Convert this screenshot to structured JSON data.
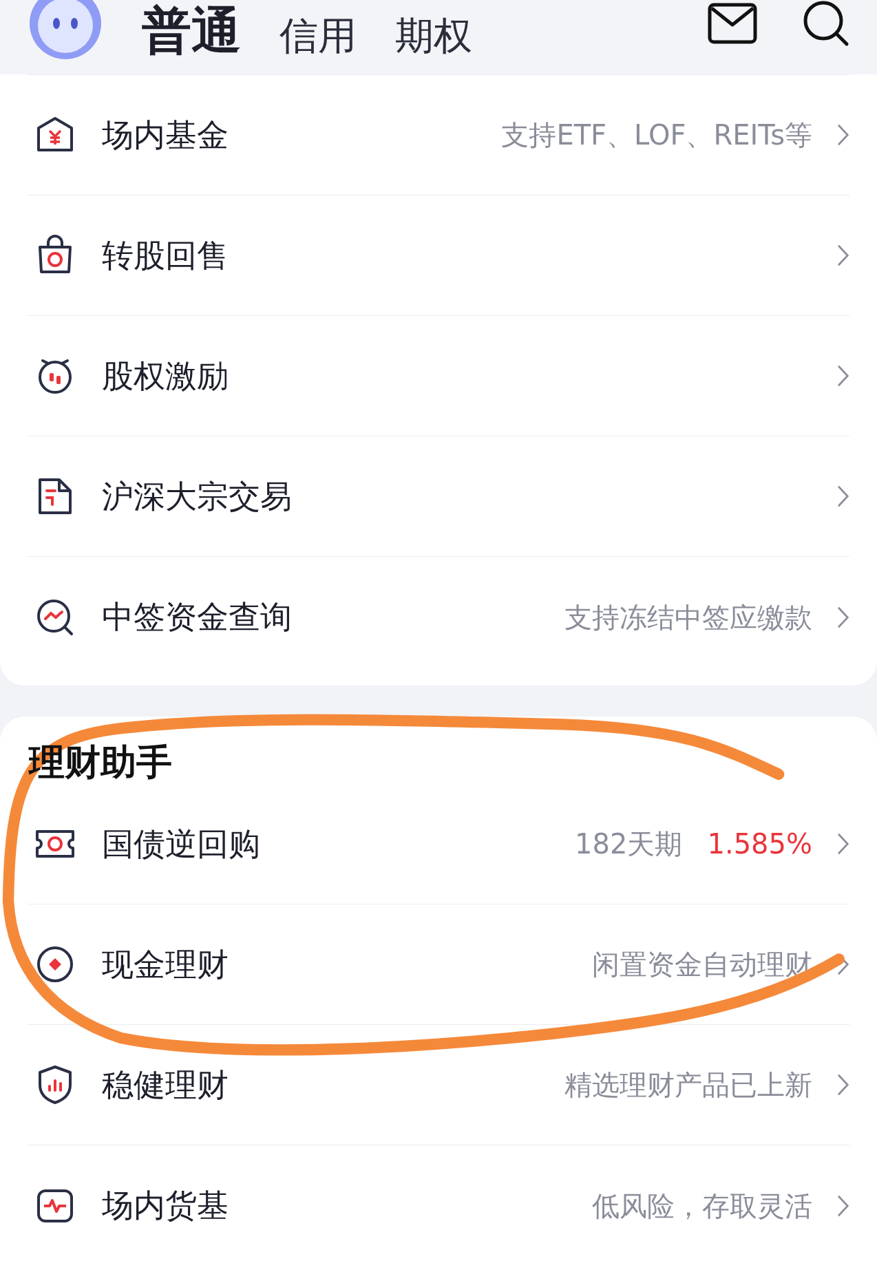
{
  "tabs": [
    {
      "label": "普通",
      "selected": true
    },
    {
      "label": "信用",
      "selected": false
    },
    {
      "label": "期权",
      "selected": false
    }
  ],
  "services": [
    {
      "label": "场内基金",
      "hint": "支持ETF、LOF、REITs等"
    },
    {
      "label": "转股回售"
    },
    {
      "label": "股权激励"
    },
    {
      "label": "沪深大宗交易"
    },
    {
      "label": "中签资金查询",
      "hint": "支持冻结中签应缴款"
    }
  ],
  "assistant": {
    "title": "理财助手",
    "items": [
      {
        "label": "国债逆回购",
        "hint": "182天期",
        "rate": "1.585%"
      },
      {
        "label": "现金理财",
        "hint": "闲置资金自动理财"
      },
      {
        "label": "稳健理财",
        "hint": "精选理财产品已上新"
      },
      {
        "label": "场内货基",
        "hint": "低风险，存取灵活"
      }
    ]
  }
}
